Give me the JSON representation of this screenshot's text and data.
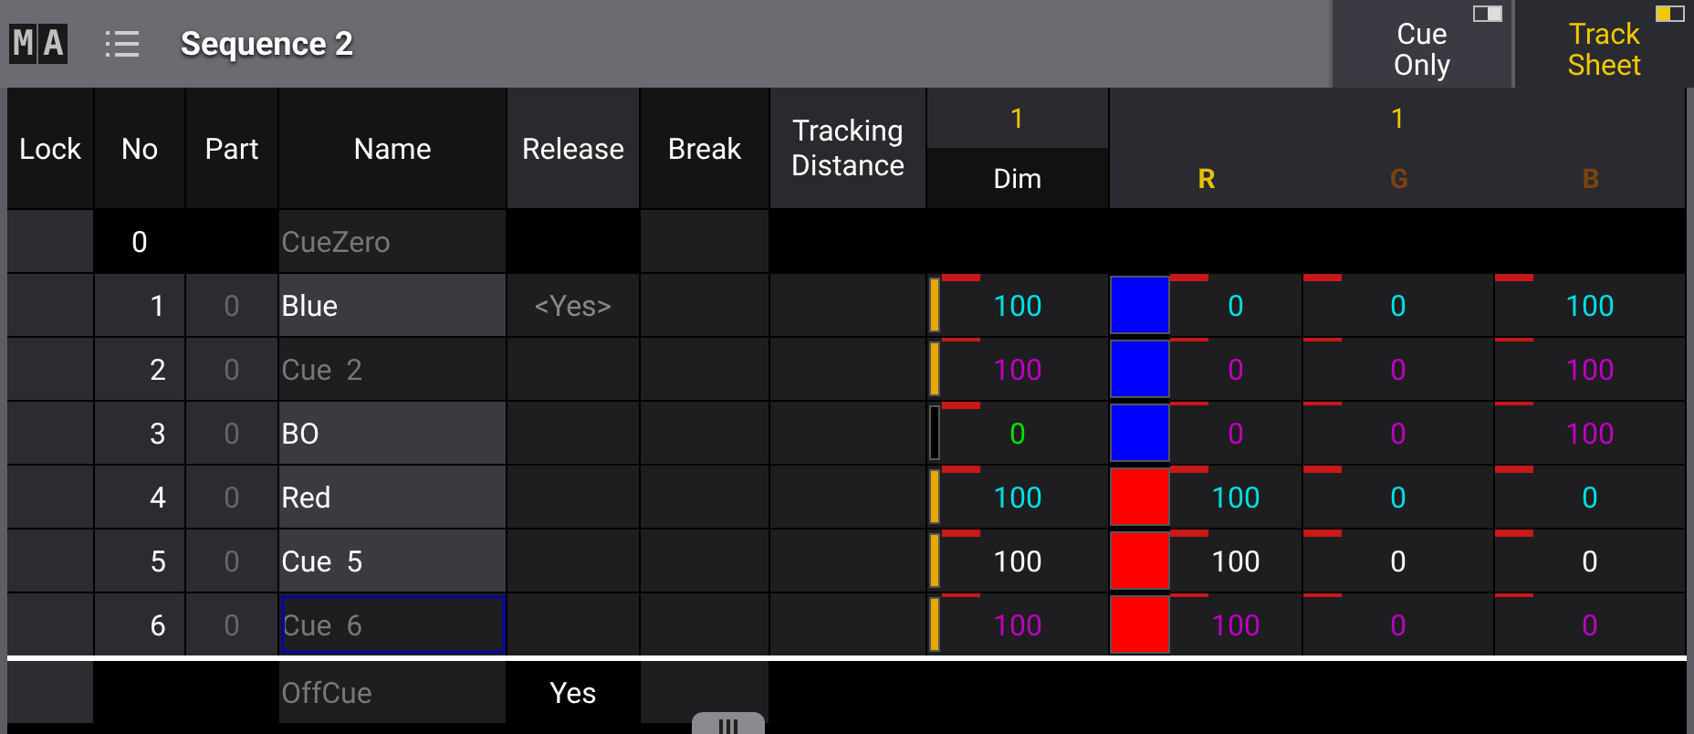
{
  "title_bar": {
    "logo": [
      "M",
      "A"
    ],
    "title": "Sequence 2",
    "buttons": [
      {
        "label": "Cue Only",
        "on": false
      },
      {
        "label": "Track Sheet",
        "on": true
      }
    ]
  },
  "columns": [
    "Lock",
    "No",
    "Part",
    "Name",
    "Release",
    "Break",
    "Tracking Distance"
  ],
  "dim_group": {
    "id": "1",
    "label": "Dim"
  },
  "rgb_group": {
    "id": "1",
    "attributes": [
      {
        "label": "R",
        "color": "#e8c000"
      },
      {
        "label": "G",
        "color": "#7a4410"
      },
      {
        "label": "B",
        "color": "#7a4410"
      }
    ]
  },
  "rows": [
    {
      "kind": "zero",
      "no": "0",
      "name": "CueZero"
    },
    {
      "kind": "cue",
      "no": "1",
      "part": "0",
      "name": "Blue",
      "named": true,
      "selected": false,
      "release": "<Yes>",
      "dim": {
        "level": 1,
        "value": "100",
        "color": "#00e0e0",
        "active": true
      },
      "swatch": {
        "color": "#0000ff"
      },
      "rgb": [
        {
          "value": "0",
          "color": "#00e0e0",
          "active": true
        },
        {
          "value": "0",
          "color": "#00e0e0",
          "active": true
        },
        {
          "value": "100",
          "color": "#00e0e0",
          "active": true
        }
      ]
    },
    {
      "kind": "cue",
      "no": "2",
      "part": "0",
      "name": "Cue  2",
      "named": false,
      "selected": false,
      "dim": {
        "level": 1,
        "value": "100",
        "color": "#c000c0",
        "active": false
      },
      "swatch": {
        "color": "#0000ff"
      },
      "rgb": [
        {
          "value": "0",
          "color": "#c000c0",
          "active": false
        },
        {
          "value": "0",
          "color": "#c000c0",
          "active": false
        },
        {
          "value": "100",
          "color": "#c000c0",
          "active": false
        }
      ]
    },
    {
      "kind": "cue",
      "no": "3",
      "part": "0",
      "name": "BO",
      "named": true,
      "selected": false,
      "dim": {
        "level": 0,
        "value": "0",
        "color": "#00e000",
        "active": true
      },
      "swatch": {
        "color": "#0000ff"
      },
      "rgb": [
        {
          "value": "0",
          "color": "#c000c0",
          "active": false
        },
        {
          "value": "0",
          "color": "#c000c0",
          "active": false
        },
        {
          "value": "100",
          "color": "#c000c0",
          "active": false
        }
      ]
    },
    {
      "kind": "cue",
      "no": "4",
      "part": "0",
      "name": "Red",
      "named": true,
      "selected": false,
      "dim": {
        "level": 1,
        "value": "100",
        "color": "#00e0e0",
        "active": true
      },
      "swatch": {
        "color": "#ff0000"
      },
      "rgb": [
        {
          "value": "100",
          "color": "#00e0e0",
          "active": true
        },
        {
          "value": "0",
          "color": "#00e0e0",
          "active": true
        },
        {
          "value": "0",
          "color": "#00e0e0",
          "active": true
        }
      ]
    },
    {
      "kind": "cue",
      "no": "5",
      "part": "0",
      "name": "Cue  5",
      "named": true,
      "selected": false,
      "dim": {
        "level": 1,
        "value": "100",
        "color": "#ffffff",
        "active": true
      },
      "swatch": {
        "color": "#ff0000"
      },
      "rgb": [
        {
          "value": "100",
          "color": "#ffffff",
          "active": true
        },
        {
          "value": "0",
          "color": "#ffffff",
          "active": true
        },
        {
          "value": "0",
          "color": "#ffffff",
          "active": true
        }
      ]
    },
    {
      "kind": "cue",
      "no": "6",
      "part": "0",
      "name": "Cue  6",
      "named": false,
      "selected": true,
      "dim": {
        "level": 1,
        "value": "100",
        "color": "#c000c0",
        "active": false
      },
      "swatch": {
        "color": "#ff0000"
      },
      "rgb": [
        {
          "value": "100",
          "color": "#c000c0",
          "active": false
        },
        {
          "value": "0",
          "color": "#c000c0",
          "active": false
        },
        {
          "value": "0",
          "color": "#c000c0",
          "active": false
        }
      ]
    },
    {
      "kind": "off",
      "name": "OffCue",
      "release": "Yes"
    }
  ]
}
